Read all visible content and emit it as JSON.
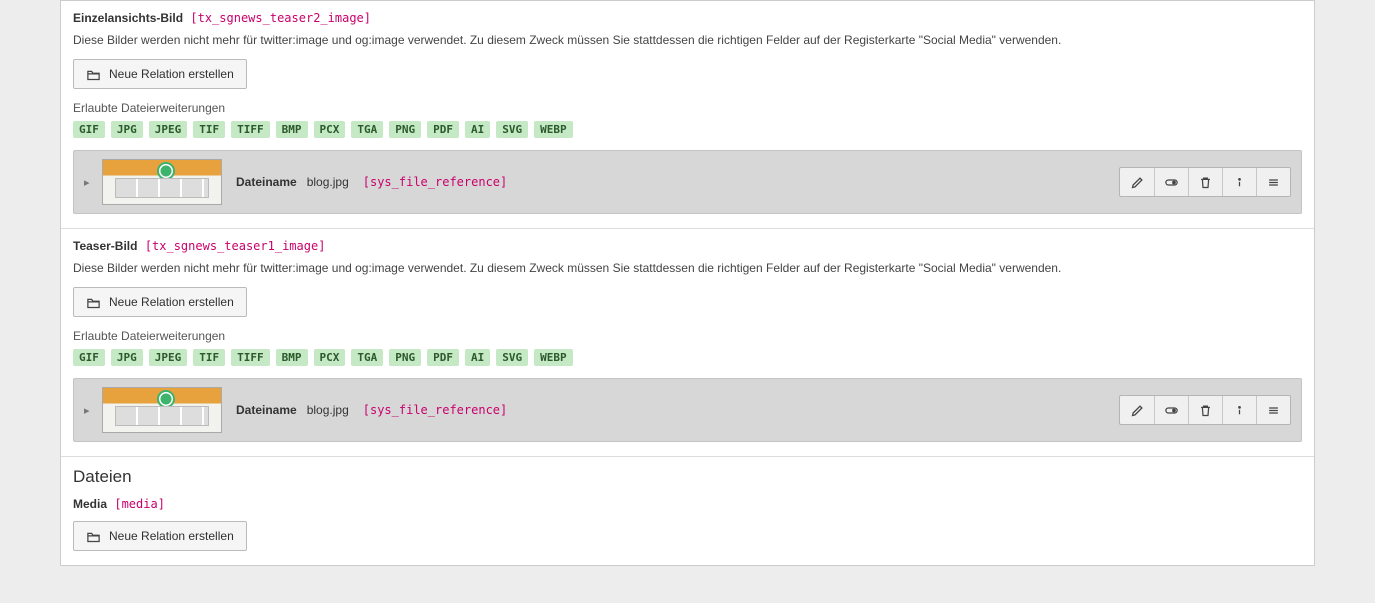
{
  "sections": [
    {
      "title": "Einzelansichts-Bild",
      "tech": "[tx_sgnews_teaser2_image]",
      "desc": "Diese Bilder werden nicht mehr für twitter:image und og:image verwendet. Zu diesem Zweck müssen Sie stattdessen die richtigen Felder auf der Registerkarte \"Social Media\" verwenden.",
      "button": "Neue Relation erstellen",
      "ext_label": "Erlaubte Dateierweiterungen",
      "exts": [
        "GIF",
        "JPG",
        "JPEG",
        "TIF",
        "TIFF",
        "BMP",
        "PCX",
        "TGA",
        "PNG",
        "PDF",
        "AI",
        "SVG",
        "WEBP"
      ],
      "file": {
        "name_label": "Dateiname",
        "name": "blog.jpg",
        "ref": "[sys_file_reference]"
      }
    },
    {
      "title": "Teaser-Bild",
      "tech": "[tx_sgnews_teaser1_image]",
      "desc": "Diese Bilder werden nicht mehr für twitter:image und og:image verwendet. Zu diesem Zweck müssen Sie stattdessen die richtigen Felder auf der Registerkarte \"Social Media\" verwenden.",
      "button": "Neue Relation erstellen",
      "ext_label": "Erlaubte Dateierweiterungen",
      "exts": [
        "GIF",
        "JPG",
        "JPEG",
        "TIF",
        "TIFF",
        "BMP",
        "PCX",
        "TGA",
        "PNG",
        "PDF",
        "AI",
        "SVG",
        "WEBP"
      ],
      "file": {
        "name_label": "Dateiname",
        "name": "blog.jpg",
        "ref": "[sys_file_reference]"
      }
    }
  ],
  "files_heading": "Dateien",
  "media": {
    "title": "Media",
    "tech": "[media]",
    "button": "Neue Relation erstellen"
  }
}
